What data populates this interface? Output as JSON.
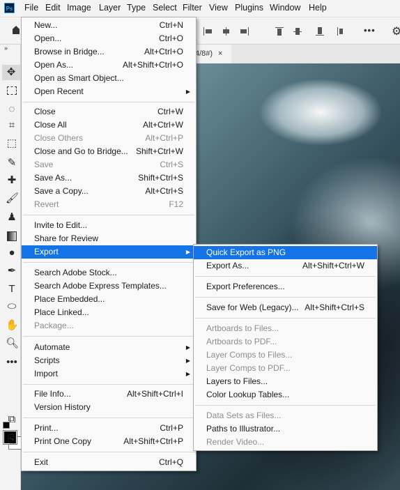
{
  "app": {
    "logo": "Ps"
  },
  "menubar": [
    "File",
    "Edit",
    "Image",
    "Layer",
    "Type",
    "Select",
    "Filter",
    "View",
    "Plugins",
    "Window",
    "Help"
  ],
  "tab": {
    "label": "4/8#)",
    "close": "×"
  },
  "toolbar": {
    "collapse": "»"
  },
  "file_menu": {
    "new": {
      "label": "New...",
      "shortcut": "Ctrl+N"
    },
    "open": {
      "label": "Open...",
      "shortcut": "Ctrl+O"
    },
    "browse_bridge": {
      "label": "Browse in Bridge...",
      "shortcut": "Alt+Ctrl+O"
    },
    "open_as": {
      "label": "Open As...",
      "shortcut": "Alt+Shift+Ctrl+O"
    },
    "open_smart": {
      "label": "Open as Smart Object..."
    },
    "open_recent": {
      "label": "Open Recent"
    },
    "close": {
      "label": "Close",
      "shortcut": "Ctrl+W"
    },
    "close_all": {
      "label": "Close All",
      "shortcut": "Alt+Ctrl+W"
    },
    "close_others": {
      "label": "Close Others",
      "shortcut": "Alt+Ctrl+P"
    },
    "close_bridge": {
      "label": "Close and Go to Bridge...",
      "shortcut": "Shift+Ctrl+W"
    },
    "save": {
      "label": "Save",
      "shortcut": "Ctrl+S"
    },
    "save_as": {
      "label": "Save As...",
      "shortcut": "Shift+Ctrl+S"
    },
    "save_copy": {
      "label": "Save a Copy...",
      "shortcut": "Alt+Ctrl+S"
    },
    "revert": {
      "label": "Revert",
      "shortcut": "F12"
    },
    "invite": {
      "label": "Invite to Edit..."
    },
    "share_review": {
      "label": "Share for Review"
    },
    "export": {
      "label": "Export"
    },
    "search_stock": {
      "label": "Search Adobe Stock..."
    },
    "search_express": {
      "label": "Search Adobe Express Templates..."
    },
    "place_embedded": {
      "label": "Place Embedded..."
    },
    "place_linked": {
      "label": "Place Linked..."
    },
    "package": {
      "label": "Package..."
    },
    "automate": {
      "label": "Automate"
    },
    "scripts": {
      "label": "Scripts"
    },
    "import": {
      "label": "Import"
    },
    "file_info": {
      "label": "File Info...",
      "shortcut": "Alt+Shift+Ctrl+I"
    },
    "version_history": {
      "label": "Version History"
    },
    "print": {
      "label": "Print...",
      "shortcut": "Ctrl+P"
    },
    "print_one": {
      "label": "Print One Copy",
      "shortcut": "Alt+Shift+Ctrl+P"
    },
    "exit": {
      "label": "Exit",
      "shortcut": "Ctrl+Q"
    }
  },
  "export_menu": {
    "quick_png": {
      "label": "Quick Export as PNG"
    },
    "export_as": {
      "label": "Export As...",
      "shortcut": "Alt+Shift+Ctrl+W"
    },
    "export_prefs": {
      "label": "Export Preferences..."
    },
    "save_web": {
      "label": "Save for Web (Legacy)...",
      "shortcut": "Alt+Shift+Ctrl+S"
    },
    "artboards_files": {
      "label": "Artboards to Files..."
    },
    "artboards_pdf": {
      "label": "Artboards to PDF..."
    },
    "comps_files": {
      "label": "Layer Comps to Files..."
    },
    "comps_pdf": {
      "label": "Layer Comps to PDF..."
    },
    "layers_files": {
      "label": "Layers to Files..."
    },
    "color_lookup": {
      "label": "Color Lookup Tables..."
    },
    "datasets": {
      "label": "Data Sets as Files..."
    },
    "paths_illustrator": {
      "label": "Paths to Illustrator..."
    },
    "render_video": {
      "label": "Render Video..."
    }
  },
  "colors": {
    "highlight": "#1473e6",
    "menu_bg": "#f9f9f9",
    "disabled_text": "#8c8c8c"
  }
}
